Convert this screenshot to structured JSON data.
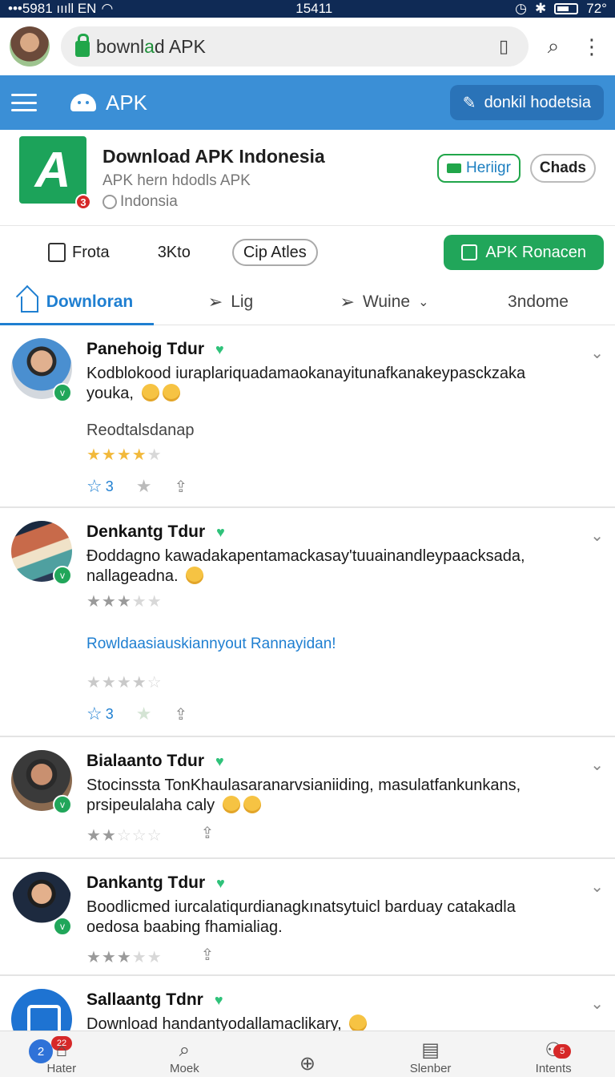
{
  "status_bar": {
    "left": "•••5981 ıııll EN",
    "time": "15411",
    "right": "72°"
  },
  "browser": {
    "url_prefix": "bownl",
    "url_highlight": "a",
    "url_suffix": "d APK"
  },
  "appbar": {
    "title": "APK",
    "action_label": "donkil hodetsia"
  },
  "app": {
    "name": "Download APK Indonesia",
    "subtitle": "APK hern hdodls APK",
    "region": "Indonsia",
    "badge": "3",
    "buttons": {
      "primary": "Heriigr",
      "secondary": "Chads"
    }
  },
  "actions": {
    "item1": "Frota",
    "item2": "3Kto",
    "pill": "Cip Atles",
    "cta": "APK Ronacen"
  },
  "tabs": [
    {
      "label": "Downloran"
    },
    {
      "label": "Lig"
    },
    {
      "label": "Wuine"
    },
    {
      "label": "3ndome"
    }
  ],
  "posts": [
    {
      "name": "Panehoig Tdur",
      "text": "Kodblokood iuraplariquadamaokanayitunafkanakeypasckzaka youka,",
      "subtitle": "Reodtalsdanap",
      "rating": 4,
      "likes": "3"
    },
    {
      "name": "Denkantg Tdur",
      "text": "Ðoddagno kawadakapentamackasay'tuuainandleypaacksada, nallageadna.",
      "link": "Rowldaasiauskiannyout Rannayidan!",
      "rating": 3,
      "rating2": 4,
      "likes": "3"
    },
    {
      "name": "Bialaanto Tdur",
      "text": "Stocinssta TonKhaulasaranarvsianiiding, masulatfankunkans, prsipeulalaha caly",
      "rating": 2
    },
    {
      "name": "Dankantg Tdur",
      "text": "Boodlicmed iurcalatiqurdianagkınatsytuicl barduay catakadla oedosa baabing fhamialiag.",
      "rating": 3
    },
    {
      "name": "Sallaantg Tdnr",
      "text": "Download handantyodallamaclikary,"
    }
  ],
  "bottom_nav": {
    "left_badge_num": "2",
    "left_badge_count": "22",
    "items": [
      {
        "label": "Hater"
      },
      {
        "label": "Moek"
      },
      {
        "label": ""
      },
      {
        "label": "Slenber"
      },
      {
        "label": "Intents",
        "badge": "5"
      }
    ]
  }
}
